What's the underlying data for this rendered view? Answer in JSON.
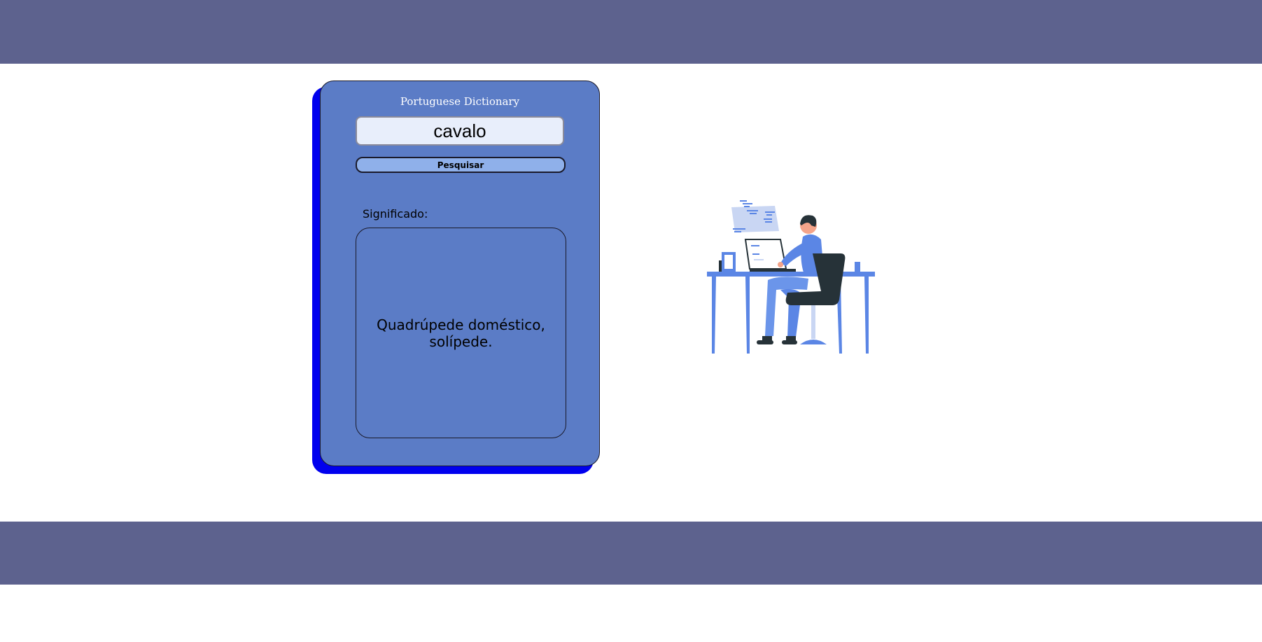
{
  "app": {
    "title": "Portuguese Dictionary"
  },
  "search": {
    "value": "cavalo",
    "button_label": "Pesquisar"
  },
  "result": {
    "label": "Significado:",
    "text": "Quadrúpede doméstico, solípede."
  },
  "colors": {
    "band": "#5d628e",
    "card": "#5b7cc6",
    "card_shadow": "#0000ee",
    "button": "#8fb0ea",
    "input_bg": "#e8eefb",
    "illustration_blue": "#5b86e5",
    "illustration_dark": "#263238"
  },
  "illustration": {
    "icon": "person-at-desk-with-laptop-illustration"
  }
}
